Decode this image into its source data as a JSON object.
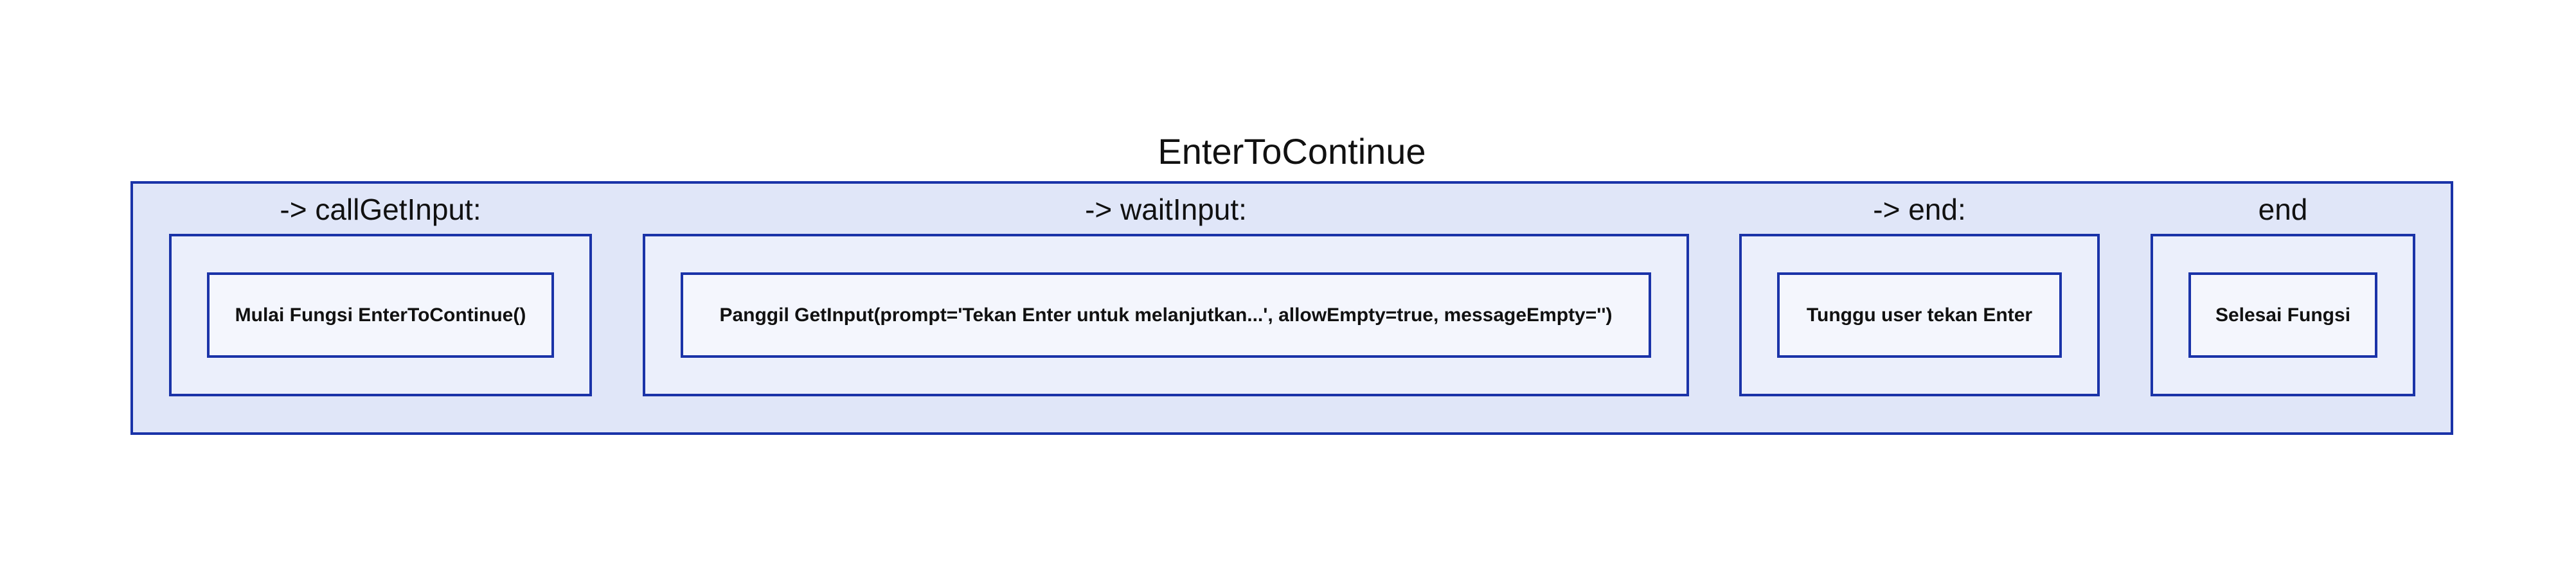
{
  "diagram": {
    "title": "EnterToContinue",
    "stages": [
      {
        "label": "-> callGetInput:",
        "step": "Mulai Fungsi EnterToContinue()"
      },
      {
        "label": "-> waitInput:",
        "step": "Panggil GetInput(prompt='Tekan Enter untuk melanjutkan...', allowEmpty=true, messageEmpty='')"
      },
      {
        "label": "-> end:",
        "step": "Tunggu user tekan Enter"
      },
      {
        "label": "end",
        "step": "Selesai Fungsi"
      }
    ],
    "colors": {
      "border": "#1a33a8",
      "outer_fill": "#e0e6f8",
      "stage_fill": "#ebeffb",
      "step_fill": "#f4f6fd",
      "text": "#111111"
    }
  }
}
